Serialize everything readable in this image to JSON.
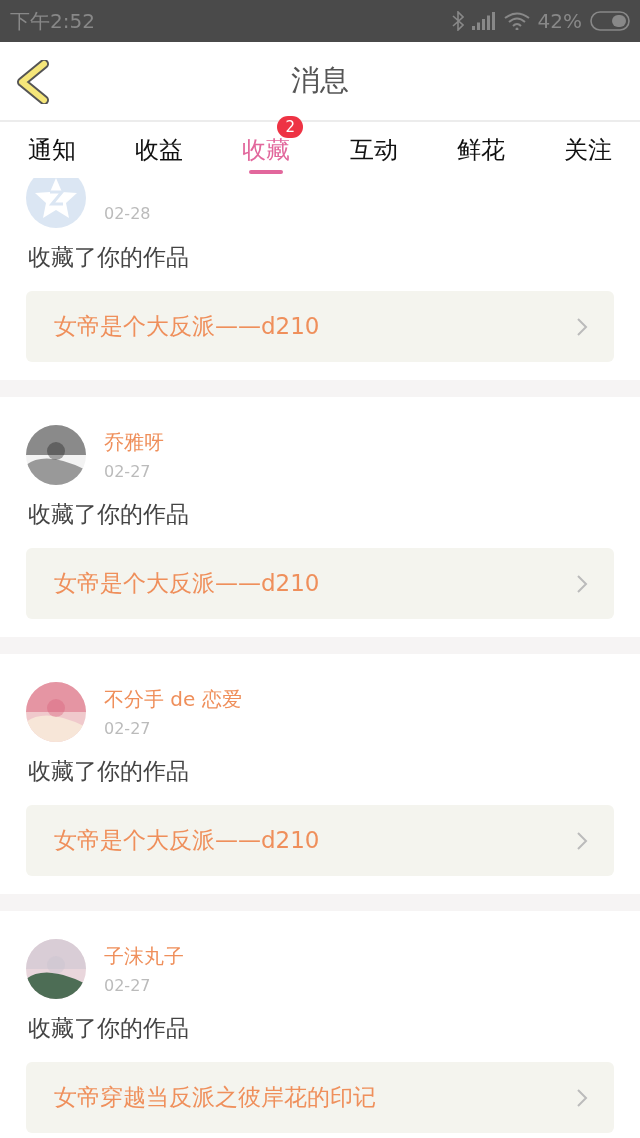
{
  "status_bar": {
    "time": "下午2:52",
    "battery": "42%"
  },
  "header": {
    "title": "消息"
  },
  "tabs": [
    {
      "label": "通知",
      "selected": false
    },
    {
      "label": "收益",
      "selected": false
    },
    {
      "label": "收藏",
      "selected": true,
      "badge": "2"
    },
    {
      "label": "互动",
      "selected": false
    },
    {
      "label": "鲜花",
      "selected": false
    },
    {
      "label": "关注",
      "selected": false
    }
  ],
  "messages": [
    {
      "date": "02-28",
      "text": "收藏了你的作品",
      "work": "女帝是个大反派——d210",
      "kind": "badge"
    },
    {
      "name": "乔雅呀",
      "date": "02-27",
      "text": "收藏了你的作品",
      "work": "女帝是个大反派——d210",
      "kind": "picture"
    },
    {
      "name": "不分手 de 恋爱",
      "date": "02-27",
      "text": "收藏了你的作品",
      "work": "女帝是个大反派——d210",
      "kind": "picture"
    },
    {
      "name": "子沫丸子",
      "date": "02-27",
      "text": "收藏了你的作品",
      "work": "女帝穿越当反派之彼岸花的印记",
      "kind": "picture"
    }
  ]
}
